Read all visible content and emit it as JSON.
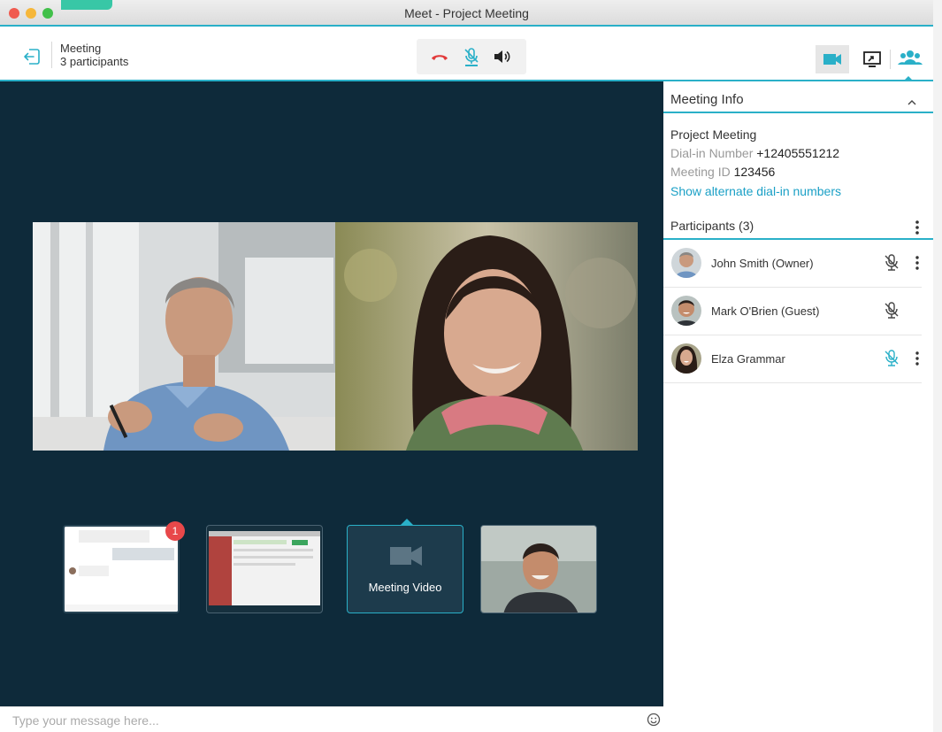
{
  "window": {
    "title": "Meet - Project Meeting"
  },
  "toolbar": {
    "meeting_label": "Meeting",
    "participants_count": "3 participants",
    "exit_icon": "exit-icon",
    "hangup_icon": "hang-up-icon",
    "mic_icon": "microphone-icon",
    "speaker_icon": "speaker-icon",
    "video_icon": "video-camera-icon",
    "share_icon": "screen-share-icon",
    "people_icon": "participants-icon",
    "accent_color": "#2ab0c8",
    "hangup_color": "#e23a3a"
  },
  "stage": {
    "background": "#0e2a3a",
    "thumbnails": [
      {
        "kind": "chat",
        "badge": "1"
      },
      {
        "kind": "screen-share"
      },
      {
        "kind": "meeting-video",
        "label": "Meeting Video"
      },
      {
        "kind": "participant-camera"
      }
    ]
  },
  "message_bar": {
    "placeholder": "Type your message here...",
    "emoji_icon": "emoji-icon"
  },
  "meeting_info": {
    "heading": "Meeting Info",
    "name": "Project Meeting",
    "dial_in_label": "Dial-in Number",
    "dial_in_value": "+12405551212",
    "id_label": "Meeting ID",
    "id_value": "123456",
    "alt_link": "Show alternate dial-in numbers"
  },
  "participants": {
    "heading": "Participants (3)",
    "items": [
      {
        "name": "John Smith (Owner)",
        "mic": "muted",
        "menu": true
      },
      {
        "name": "Mark O'Brien (Guest)",
        "mic": "muted",
        "menu": false
      },
      {
        "name": "Elza Grammar",
        "mic": "active",
        "menu": true
      }
    ]
  }
}
